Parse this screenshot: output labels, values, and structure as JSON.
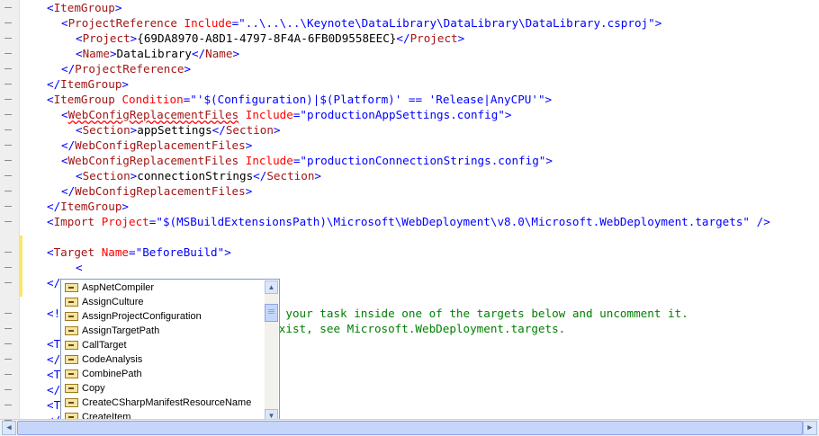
{
  "editor": {
    "lines": [
      {
        "indent": 0,
        "segments": [
          [
            "b",
            "<"
          ],
          [
            "t",
            "ItemGroup"
          ],
          [
            "b",
            ">"
          ]
        ]
      },
      {
        "indent": 1,
        "segments": [
          [
            "b",
            "<"
          ],
          [
            "t",
            "ProjectReference"
          ],
          [
            "x",
            " "
          ],
          [
            "a",
            "Include"
          ],
          [
            "b",
            "=\""
          ],
          [
            "v",
            "..\\..\\..\\Keynote\\DataLibrary\\DataLibrary\\DataLibrary.csproj"
          ],
          [
            "b",
            "\">"
          ]
        ]
      },
      {
        "indent": 2,
        "segments": [
          [
            "b",
            "<"
          ],
          [
            "t",
            "Project"
          ],
          [
            "b",
            ">"
          ],
          [
            "x",
            "{69DA8970-A8D1-4797-8F4A-6FB0D9558EEC}"
          ],
          [
            "b",
            "</"
          ],
          [
            "t",
            "Project"
          ],
          [
            "b",
            ">"
          ]
        ]
      },
      {
        "indent": 2,
        "segments": [
          [
            "b",
            "<"
          ],
          [
            "t",
            "Name"
          ],
          [
            "b",
            ">"
          ],
          [
            "x",
            "DataLibrary"
          ],
          [
            "b",
            "</"
          ],
          [
            "t",
            "Name"
          ],
          [
            "b",
            ">"
          ]
        ]
      },
      {
        "indent": 1,
        "segments": [
          [
            "b",
            "</"
          ],
          [
            "t",
            "ProjectReference"
          ],
          [
            "b",
            ">"
          ]
        ]
      },
      {
        "indent": 0,
        "segments": [
          [
            "b",
            "</"
          ],
          [
            "t",
            "ItemGroup"
          ],
          [
            "b",
            ">"
          ]
        ]
      },
      {
        "indent": 0,
        "segments": [
          [
            "b",
            "<"
          ],
          [
            "t",
            "ItemGroup"
          ],
          [
            "x",
            " "
          ],
          [
            "a",
            "Condition"
          ],
          [
            "b",
            "=\""
          ],
          [
            "v",
            "'$(Configuration)|$(Platform)' == 'Release|AnyCPU'"
          ],
          [
            "b",
            "\">"
          ]
        ]
      },
      {
        "indent": 1,
        "segments": [
          [
            "b",
            "<"
          ],
          [
            "tq",
            "WebConfigReplacementFiles"
          ],
          [
            "x",
            " "
          ],
          [
            "a",
            "Include"
          ],
          [
            "b",
            "=\""
          ],
          [
            "v",
            "productionAppSettings.config"
          ],
          [
            "b",
            "\">"
          ]
        ]
      },
      {
        "indent": 2,
        "segments": [
          [
            "b",
            "<"
          ],
          [
            "t",
            "Section"
          ],
          [
            "b",
            ">"
          ],
          [
            "x",
            "appSettings"
          ],
          [
            "b",
            "</"
          ],
          [
            "t",
            "Section"
          ],
          [
            "b",
            ">"
          ]
        ]
      },
      {
        "indent": 1,
        "segments": [
          [
            "b",
            "</"
          ],
          [
            "t",
            "WebConfigReplacementFiles"
          ],
          [
            "b",
            ">"
          ]
        ]
      },
      {
        "indent": 1,
        "segments": [
          [
            "b",
            "<"
          ],
          [
            "t",
            "WebConfigReplacementFiles"
          ],
          [
            "x",
            " "
          ],
          [
            "a",
            "Include"
          ],
          [
            "b",
            "=\""
          ],
          [
            "v",
            "productionConnectionStrings.config"
          ],
          [
            "b",
            "\">"
          ]
        ]
      },
      {
        "indent": 2,
        "segments": [
          [
            "b",
            "<"
          ],
          [
            "t",
            "Section"
          ],
          [
            "b",
            ">"
          ],
          [
            "x",
            "connectionStrings"
          ],
          [
            "b",
            "</"
          ],
          [
            "t",
            "Section"
          ],
          [
            "b",
            ">"
          ]
        ]
      },
      {
        "indent": 1,
        "segments": [
          [
            "b",
            "</"
          ],
          [
            "t",
            "WebConfigReplacementFiles"
          ],
          [
            "b",
            ">"
          ]
        ]
      },
      {
        "indent": 0,
        "segments": [
          [
            "b",
            "</"
          ],
          [
            "t",
            "ItemGroup"
          ],
          [
            "b",
            ">"
          ]
        ]
      },
      {
        "indent": 0,
        "segments": [
          [
            "b",
            "<"
          ],
          [
            "t",
            "Import"
          ],
          [
            "x",
            " "
          ],
          [
            "a",
            "Project"
          ],
          [
            "b",
            "=\""
          ],
          [
            "v",
            "$(MSBuildExtensionsPath)\\Microsoft\\WebDeployment\\v8.0\\Microsoft.WebDeployment.targets"
          ],
          [
            "b",
            "\""
          ],
          [
            "x",
            " "
          ],
          [
            "b",
            "/>"
          ]
        ]
      },
      {
        "indent": 0,
        "segments": []
      },
      {
        "indent": 0,
        "segments": [
          [
            "b",
            "<"
          ],
          [
            "t",
            "Target"
          ],
          [
            "x",
            " "
          ],
          [
            "a",
            "Name"
          ],
          [
            "b",
            "=\""
          ],
          [
            "v",
            "BeforeBuild"
          ],
          [
            "b",
            "\">"
          ]
        ]
      },
      {
        "indent": 2,
        "segments": [
          [
            "b",
            "<"
          ]
        ]
      },
      {
        "indent": 0,
        "segments": [
          [
            "b",
            "</"
          ]
        ]
      },
      {
        "indent": 0,
        "segments": []
      },
      {
        "indent": 0,
        "segments": [
          [
            "b",
            "<!"
          ],
          [
            "g",
            "                          e, add your task inside one of the targets below and uncomment it."
          ]
        ]
      },
      {
        "indent": 0,
        "segments": [
          [
            "g",
            "                              ts exist, see Microsoft.WebDeployment.targets."
          ]
        ]
      },
      {
        "indent": 0,
        "segments": [
          [
            "b",
            "<T"
          ]
        ]
      },
      {
        "indent": 0,
        "segments": [
          [
            "b",
            "</"
          ]
        ]
      },
      {
        "indent": 0,
        "segments": [
          [
            "b",
            "<T"
          ]
        ]
      },
      {
        "indent": 0,
        "segments": [
          [
            "b",
            "</"
          ]
        ]
      },
      {
        "indent": 0,
        "segments": [
          [
            "b",
            "<T"
          ]
        ]
      },
      {
        "indent": 0,
        "segments": [
          [
            "b",
            "</"
          ]
        ]
      }
    ]
  },
  "completion": {
    "items": [
      "AspNetCompiler",
      "AssignCulture",
      "AssignProjectConfiguration",
      "AssignTargetPath",
      "CallTarget",
      "CodeAnalysis",
      "CombinePath",
      "Copy",
      "CreateCSharpManifestResourceName",
      "CreateItem"
    ],
    "item_icon": "task-icon",
    "scroll_up": "▲",
    "scroll_down": "▼"
  },
  "hscroll": {
    "left": "◀",
    "right": "▶"
  },
  "colors": {
    "tag": "#a31515",
    "bracket": "#0000ff",
    "attr": "#ff0000",
    "comment": "#008000",
    "change_marker": "#ffe46b"
  }
}
